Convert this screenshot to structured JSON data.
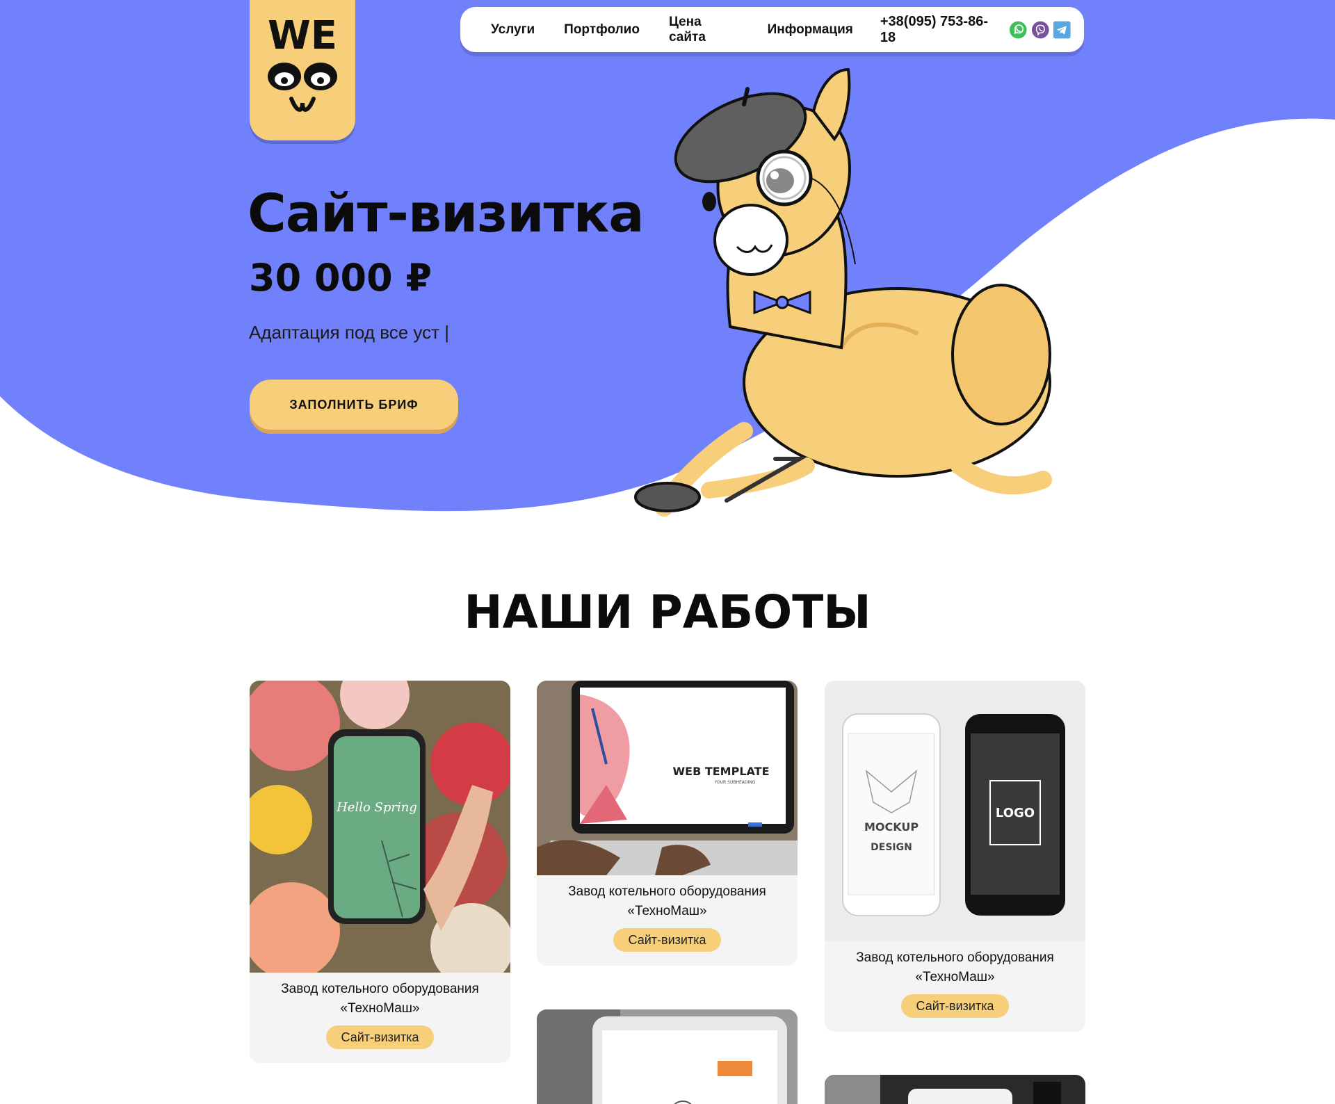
{
  "brand": {
    "logo_text": "WE"
  },
  "nav": {
    "items": [
      {
        "label": "Услуги"
      },
      {
        "label": "Портфолио"
      },
      {
        "label": "Цена сайта"
      },
      {
        "label": "Информация"
      }
    ],
    "phone": "+38(095) 753-86-18",
    "messengers": [
      "whatsapp-icon",
      "viber-icon",
      "telegram-icon"
    ]
  },
  "hero": {
    "title": "Сайт-визитка",
    "price": "30 000 ₽",
    "subtitle": "Адаптация под все уст |",
    "button": "ЗАПОЛНИТЬ БРИФ"
  },
  "works": {
    "title": "НАШИ РАБОТЫ",
    "cards": [
      {
        "image": "phone-spring-mockup",
        "caption": "Завод котельного оборудования «ТехноМаш»",
        "tag": "Сайт-визитка",
        "mockup_text": "Hello Spring"
      },
      {
        "image": "laptop-web-template",
        "caption": "Завод котельного оборудования «ТехноМаш»",
        "tag": "Сайт-визитка",
        "mockup_text": "WEB TEMPLATE",
        "mockup_sub": "YOUR SUBHEADING"
      },
      {
        "image": "two-phones-mockup",
        "caption": "Завод котельного оборудования «ТехноМаш»",
        "tag": "Сайт-визитка",
        "mockup_text": "MOCKUP",
        "mockup_sub": "DESIGN",
        "mockup_logo": "LOGO"
      },
      {
        "image": "tablet-mockup"
      },
      {
        "image": "dark-mockup"
      }
    ]
  },
  "colors": {
    "hero_bg": "#7180fb",
    "accent_yellow": "#f7cf7a",
    "card_bg": "#f4f4f4"
  }
}
